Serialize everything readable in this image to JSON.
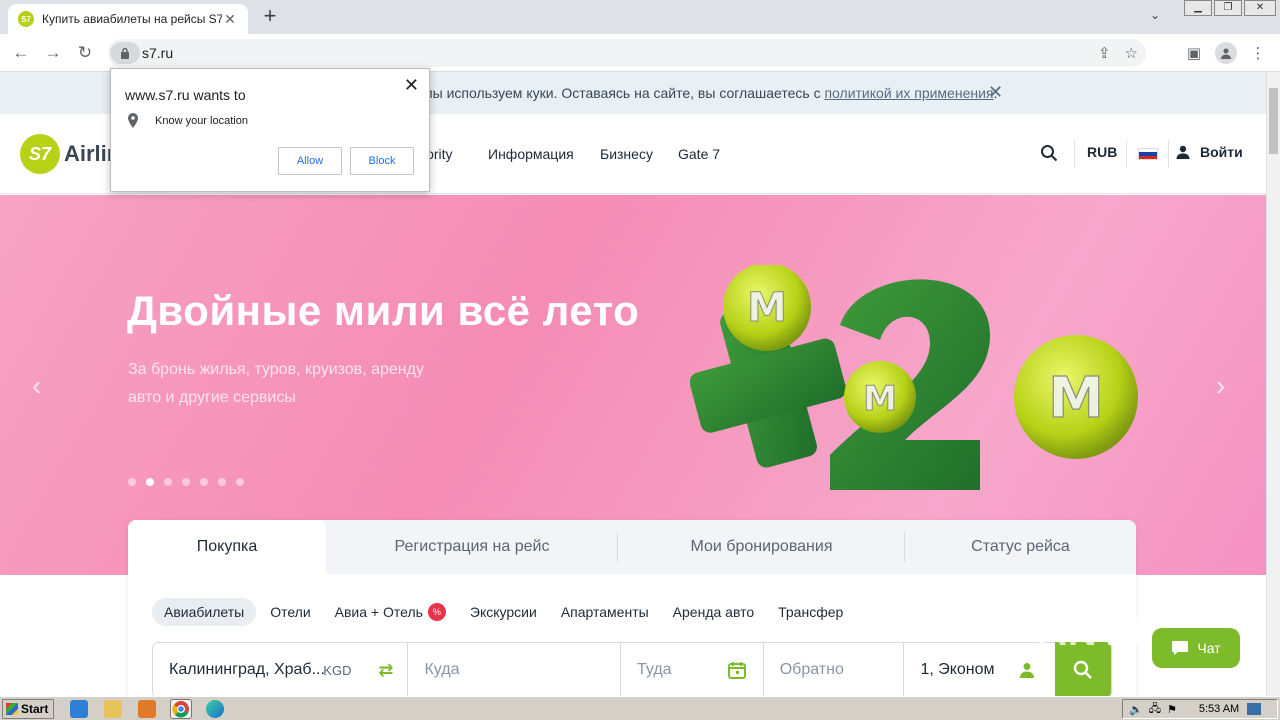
{
  "browser": {
    "tab_title": "Купить авиабилеты на рейсы S7 А",
    "tab_favicon": "S7",
    "url": "s7.ru",
    "new_tab": "+",
    "tab_close": "✕"
  },
  "permission": {
    "host": "www.s7.ru wants to",
    "request": "Know your location",
    "allow": "Allow",
    "block": "Block"
  },
  "cookie": {
    "text": "мы используем куки. Оставаясь на сайте, вы соглашаетесь с",
    "link": "политикой их применения",
    "end": "."
  },
  "header": {
    "logo_mark": "S7",
    "logo_word": "Airlines",
    "nav": [
      "iority",
      "Информация",
      "Бизнесу",
      "Gate 7"
    ],
    "currency": "RUB",
    "login": "Войти"
  },
  "hero": {
    "title": "Двойные мили всё лето",
    "subtitle": "За бронь жилья, туров, круизов, аренду авто и другие сервисы",
    "active_slide": 1,
    "slide_count": 7
  },
  "booking": {
    "tabs": [
      "Покупка",
      "Регистрация на рейс",
      "Мои бронирования",
      "Статус рейса"
    ],
    "products": [
      "Авиабилеты",
      "Отели",
      "Авиа + Отель",
      "Экскурсии",
      "Апартаменты",
      "Аренда авто",
      "Трансфер"
    ],
    "badge": "%",
    "from": "Калининград, Храб...",
    "from_code": "KGD",
    "to_placeholder": "Куда",
    "depart_placeholder": "Туда",
    "return_placeholder": "Обратно",
    "passengers": "1, Эконом"
  },
  "chat": "Чат",
  "watermark": "ANY.RUN",
  "taskbar": {
    "start": "Start",
    "time": "5:53 AM"
  },
  "colors": {
    "brand": "#b6d116",
    "accent_green": "#7dbb2b",
    "hero_pink": "#f58cb4"
  }
}
